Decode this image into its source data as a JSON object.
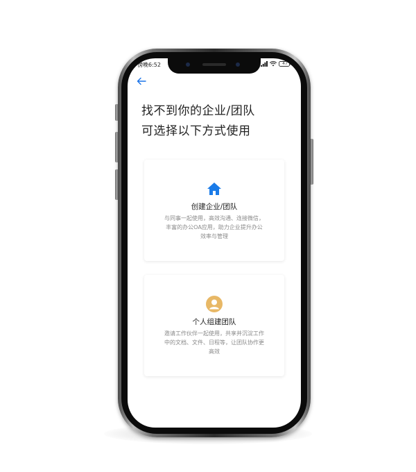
{
  "status_bar": {
    "time": "傍晚6:52",
    "battery": "47",
    "icons": [
      "signal-icon",
      "wifi-icon",
      "battery-icon"
    ]
  },
  "navigation": {
    "back_icon": "arrow-left-icon",
    "accent_color": "#1a73e8"
  },
  "page": {
    "title_lines": [
      "找不到你的企业/团队",
      "可选择以下方式使用"
    ]
  },
  "options": [
    {
      "icon": "house-icon",
      "icon_color": "#1a7be8",
      "title": "创建企业/团队",
      "description_lines": [
        "与同事一起使用，高效沟通、连接微信，",
        "丰富的办公OA应用，助力企业提升办公",
        "效率与管理"
      ]
    },
    {
      "icon": "person-icon",
      "icon_color": "#e8b866",
      "title": "个人组建团队",
      "description_lines": [
        "邀请工作伙伴一起使用，共享并沉淀工作",
        "中的文档、文件、日程等，让团队协作更",
        "高效"
      ]
    }
  ]
}
